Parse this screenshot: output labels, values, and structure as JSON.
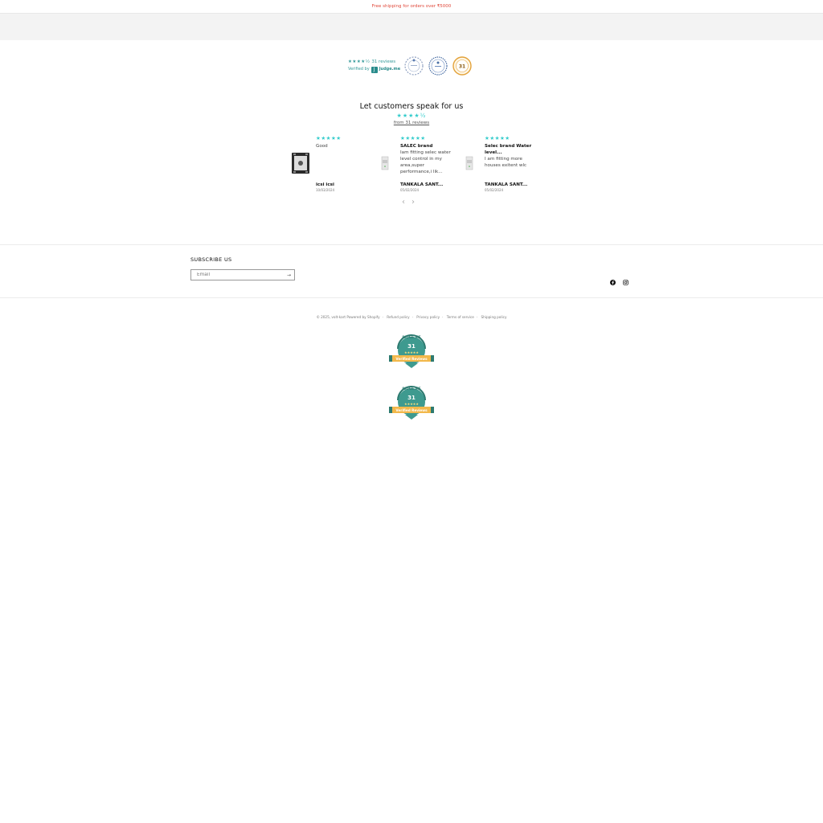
{
  "announcement": {
    "text": "Free shipping for orders over ₹5000"
  },
  "reviews_badge": {
    "stars": "★★★★½",
    "count_text": "31 reviews",
    "verified_by": "Verified by",
    "judgeme_label": "Judge.me",
    "judgeme_logo_letter": "J"
  },
  "medals": {
    "gold_count": "31"
  },
  "carousel": {
    "title": "Let customers speak for us",
    "stars": "★★★★½",
    "from_text": "from 31 reviews",
    "prev_icon": "‹",
    "next_icon": "›",
    "reviews": [
      {
        "stars": "★★★★★",
        "title": "",
        "text": "Good",
        "name": "icsi icsi",
        "date": "10/03/2024"
      },
      {
        "stars": "★★★★★",
        "title": "SALEC brand",
        "text": "Iam fitting selec water level control in my area,super performance,i lik...",
        "name": "TANKALA SANT...",
        "date": "05/02/2024"
      },
      {
        "stars": "★★★★★",
        "title": "Selec brand Water level...",
        "text": "I am fitting more houses exitent wlc",
        "name": "TANKALA SANT...",
        "date": "05/02/2024"
      }
    ]
  },
  "footer": {
    "subscribe_title": "SUBSCRIBE US",
    "email_placeholder": "Email",
    "submit_icon": "→",
    "social": [
      "facebook-icon",
      "instagram-icon"
    ],
    "legal_links": [
      "© 2025, volt-kart Powered by Shopify",
      "Refund policy",
      "Privacy policy",
      "Terms of service",
      "Shipping policy"
    ]
  },
  "judgeme_badges": [
    {
      "top_text": "JUDGE.ME",
      "count": "31",
      "stars": "★★★★★",
      "ribbon": "Verified Reviews"
    },
    {
      "top_text": "JUDGE.ME",
      "count": "31",
      "stars": "★★★★★",
      "ribbon": "Verified Reviews"
    }
  ],
  "colors": {
    "teal": "#339999",
    "star": "#33cccc",
    "announce": "#e0483a",
    "gold": "#e3a23a"
  }
}
